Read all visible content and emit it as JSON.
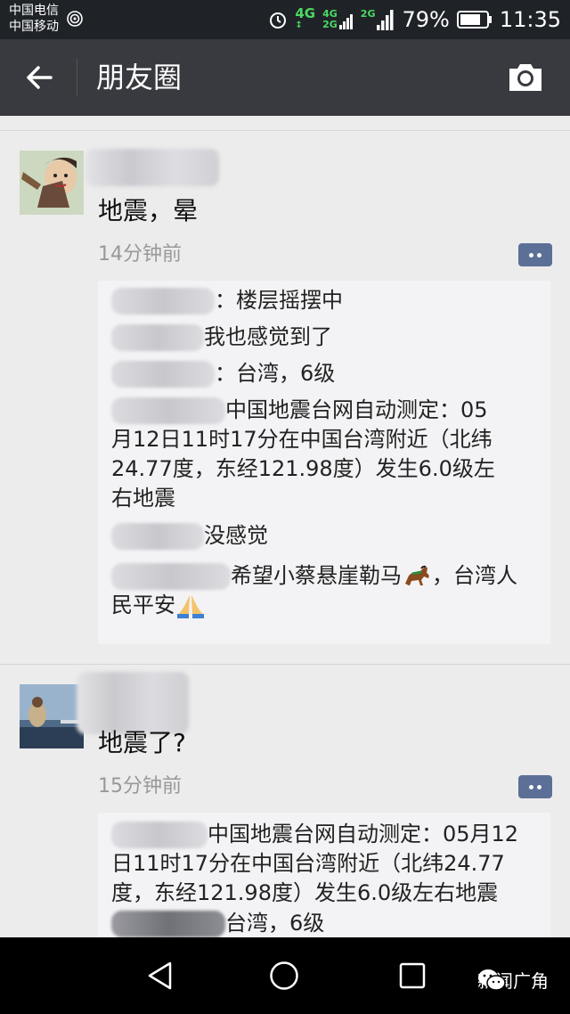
{
  "status_bar": {
    "carrier_1": "中国电信",
    "carrier_2": "中国移动",
    "network_main": "4G",
    "network_sub_top": "4G",
    "network_sub_bottom": "2G",
    "network_2g": "2G",
    "battery": "79%",
    "time": "11:35"
  },
  "title_bar": {
    "title": "朋友圈",
    "back_icon": "arrow-left-icon",
    "camera_icon": "camera-icon"
  },
  "posts": [
    {
      "text": "地震，晕",
      "time": "14分钟前",
      "comments": [
        "：楼层摇摆中",
        "我也感觉到了",
        "：台湾，6级",
        "中国地震台网自动测定：05",
        "月12日11时17分在中国台湾附近（北纬",
        "24.77度，东经121.98度）发生6.0级左",
        "右地震",
        "没感觉",
        "希望小蔡悬崖勒马",
        "，台湾人",
        "民平安"
      ]
    },
    {
      "text": "地震了?",
      "time": "15分钟前",
      "comments": [
        "中国地震台网自动测定：05月12",
        "日11时17分在中国台湾附近（北纬24.77",
        "度，东经121.98度）发生6.0级左右地震",
        "台湾，6级"
      ]
    }
  ],
  "watermark": "新闻广角",
  "colors": {
    "status_bg": "#1f2327",
    "title_bg": "#393a3f",
    "comment_bg": "#f3f3f5",
    "comment_btn": "#5b6f97",
    "accent_green": "#4cd964"
  }
}
